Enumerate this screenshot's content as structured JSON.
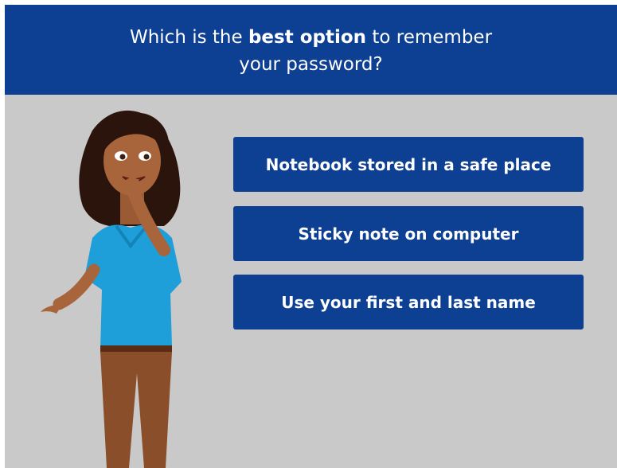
{
  "question": {
    "prefix": "Which is the",
    "bold": "best option",
    "suffix": "to remember",
    "line2": "your password?"
  },
  "options": [
    {
      "label": "Notebook stored in a safe place"
    },
    {
      "label": "Sticky note on computer"
    },
    {
      "label": "Use your first and last name"
    }
  ],
  "colors": {
    "header": "#0d3f93",
    "button": "#0d3f93",
    "background": "#c9c9c9",
    "shirt": "#1f9fd9",
    "pants": "#8a4f2a",
    "hair": "#2a140c",
    "skin": "#a8643a"
  }
}
